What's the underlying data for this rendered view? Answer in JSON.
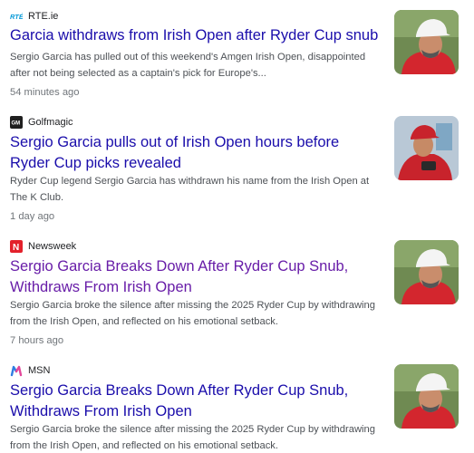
{
  "articles": [
    {
      "source": "RTE.ie",
      "favicon": "rte-logo-icon",
      "title": "Garcia withdraws from Irish Open after Ryder Cup snub",
      "snippet": "Sergio Garcia has pulled out of this weekend's Amgen Irish Open, disappointed after not being selected as a captain's pick for Europe's...",
      "time": "54 minutes ago",
      "thumbnail": "garcia-white-cap-photo"
    },
    {
      "source": "Golfmagic",
      "favicon": "golfmagic-logo-icon",
      "title": "Sergio Garcia pulls out of Irish Open hours before Ryder Cup picks revealed",
      "snippet": "Ryder Cup legend Sergio Garcia has withdrawn his name from the Irish Open at The K Club.",
      "time": "1 day ago",
      "thumbnail": "garcia-red-cap-photo"
    },
    {
      "source": "Newsweek",
      "favicon": "newsweek-logo-icon",
      "title": "Sergio Garcia Breaks Down After Ryder Cup Snub, Withdraws From Irish Open",
      "snippet": "Sergio Garcia broke the silence after missing the 2025 Ryder Cup by withdrawing from the Irish Open, and reflected on his emotional setback.",
      "time": "7 hours ago",
      "thumbnail": "garcia-white-cap-photo"
    },
    {
      "source": "MSN",
      "favicon": "msn-logo-icon",
      "title": "Sergio Garcia Breaks Down After Ryder Cup Snub, Withdraws From Irish Open",
      "snippet": "Sergio Garcia broke the silence after missing the 2025 Ryder Cup by withdrawing from the Irish Open, and reflected on his emotional setback.",
      "time": "",
      "thumbnail": "garcia-white-cap-photo"
    }
  ],
  "colors": {
    "link": "#1a0dab",
    "visited": "#681da8",
    "snippet": "#4d5156",
    "meta": "#70757a"
  }
}
